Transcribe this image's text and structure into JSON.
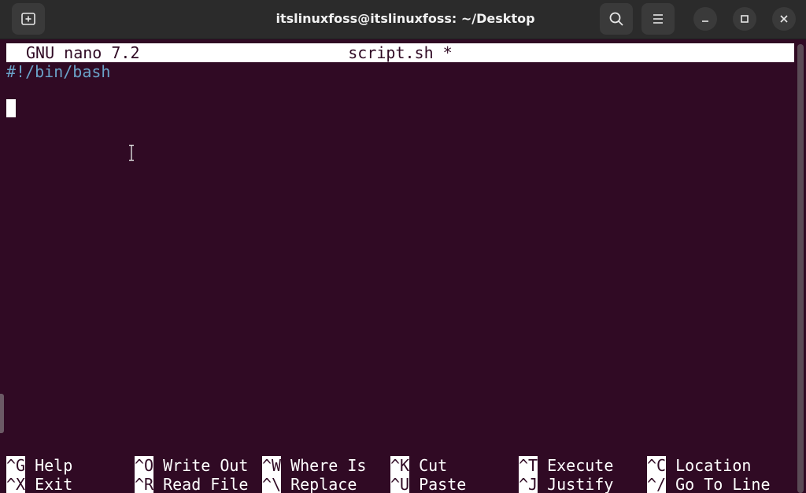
{
  "window": {
    "title": "itslinuxfoss@itslinuxfoss: ~/Desktop",
    "icons": {
      "new_tab": "new-tab-icon",
      "search": "search-icon",
      "menu": "hamburger-menu-icon",
      "minimize": "minimize-icon",
      "maximize": "maximize-icon",
      "close": "close-icon"
    }
  },
  "nano": {
    "version": "GNU nano 7.2",
    "filename": "script.sh *",
    "lines": [
      "#!/bin/bash",
      ""
    ],
    "shortcuts": [
      {
        "key": "^G",
        "label": "Help"
      },
      {
        "key": "^O",
        "label": "Write Out"
      },
      {
        "key": "^W",
        "label": "Where Is"
      },
      {
        "key": "^K",
        "label": "Cut"
      },
      {
        "key": "^T",
        "label": "Execute"
      },
      {
        "key": "^C",
        "label": "Location"
      },
      {
        "key": "^X",
        "label": "Exit"
      },
      {
        "key": "^R",
        "label": "Read File"
      },
      {
        "key": "^\\",
        "label": "Replace"
      },
      {
        "key": "^U",
        "label": "Paste"
      },
      {
        "key": "^J",
        "label": "Justify"
      },
      {
        "key": "^/",
        "label": "Go To Line"
      }
    ]
  },
  "colors": {
    "terminal_bg": "#300a24",
    "shebang": "#6aa2c8",
    "titlebar_bg": "#2b2b2b"
  }
}
